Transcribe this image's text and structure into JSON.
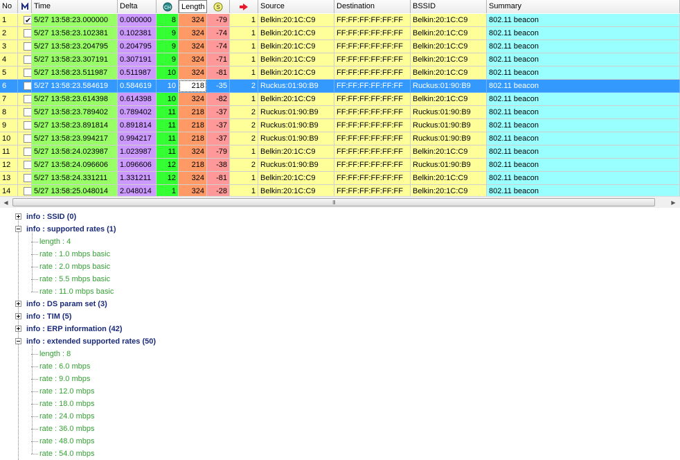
{
  "columns": {
    "no": "No",
    "time": "Time",
    "delta": "Delta",
    "length": "Length",
    "source": "Source",
    "destination": "Destination",
    "bssid": "BSSID",
    "summary": "Summary"
  },
  "column_icons": [
    "mark-icon",
    "channel-icon",
    "signal-icon",
    "retry-arrow-icon"
  ],
  "column_colors": {
    "no": "#ffff99",
    "mark": "#ffff99",
    "time": "#99ff66",
    "delta": "#cc99ff",
    "channel": "#33ff33",
    "length": "#ff9966",
    "signal": "#ff9999",
    "retry": "#ffff99",
    "addresses": "#ffff99",
    "summary": "#99ffff",
    "selected_row": "#3399ff"
  },
  "packets": [
    {
      "no": "1",
      "marked": true,
      "time": "5/27 13:58:23.000000",
      "delta": "0.000000",
      "ch": "8",
      "len": "324",
      "sig": "-79",
      "r": "1",
      "src": "Belkin:20:1C:C9",
      "dst": "FF:FF:FF:FF:FF:FF",
      "bssid": "Belkin:20:1C:C9",
      "summary": "802.11 beacon"
    },
    {
      "no": "2",
      "marked": false,
      "time": "5/27 13:58:23.102381",
      "delta": "0.102381",
      "ch": "9",
      "len": "324",
      "sig": "-74",
      "r": "1",
      "src": "Belkin:20:1C:C9",
      "dst": "FF:FF:FF:FF:FF:FF",
      "bssid": "Belkin:20:1C:C9",
      "summary": "802.11 beacon"
    },
    {
      "no": "3",
      "marked": false,
      "time": "5/27 13:58:23.204795",
      "delta": "0.204795",
      "ch": "9",
      "len": "324",
      "sig": "-74",
      "r": "1",
      "src": "Belkin:20:1C:C9",
      "dst": "FF:FF:FF:FF:FF:FF",
      "bssid": "Belkin:20:1C:C9",
      "summary": "802.11 beacon"
    },
    {
      "no": "4",
      "marked": false,
      "time": "5/27 13:58:23.307191",
      "delta": "0.307191",
      "ch": "9",
      "len": "324",
      "sig": "-71",
      "r": "1",
      "src": "Belkin:20:1C:C9",
      "dst": "FF:FF:FF:FF:FF:FF",
      "bssid": "Belkin:20:1C:C9",
      "summary": "802.11 beacon"
    },
    {
      "no": "5",
      "marked": false,
      "time": "5/27 13:58:23.511987",
      "delta": "0.511987",
      "ch": "10",
      "len": "324",
      "sig": "-81",
      "r": "1",
      "src": "Belkin:20:1C:C9",
      "dst": "FF:FF:FF:FF:FF:FF",
      "bssid": "Belkin:20:1C:C9",
      "summary": "802.11 beacon"
    },
    {
      "no": "6",
      "marked": false,
      "selected": true,
      "time": "5/27 13:58:23.584619",
      "delta": "0.584619",
      "ch": "10",
      "len": "218",
      "sig": "-35",
      "r": "2",
      "src": "Ruckus:01:90:B9",
      "dst": "FF:FF:FF:FF:FF:FF",
      "bssid": "Ruckus:01:90:B9",
      "summary": "802.11 beacon"
    },
    {
      "no": "7",
      "marked": false,
      "time": "5/27 13:58:23.614398",
      "delta": "0.614398",
      "ch": "10",
      "len": "324",
      "sig": "-82",
      "r": "1",
      "src": "Belkin:20:1C:C9",
      "dst": "FF:FF:FF:FF:FF:FF",
      "bssid": "Belkin:20:1C:C9",
      "summary": "802.11 beacon"
    },
    {
      "no": "8",
      "marked": false,
      "time": "5/27 13:58:23.789402",
      "delta": "0.789402",
      "ch": "11",
      "len": "218",
      "sig": "-37",
      "r": "2",
      "src": "Ruckus:01:90:B9",
      "dst": "FF:FF:FF:FF:FF:FF",
      "bssid": "Ruckus:01:90:B9",
      "summary": "802.11 beacon"
    },
    {
      "no": "9",
      "marked": false,
      "time": "5/27 13:58:23.891814",
      "delta": "0.891814",
      "ch": "11",
      "len": "218",
      "sig": "-37",
      "r": "2",
      "src": "Ruckus:01:90:B9",
      "dst": "FF:FF:FF:FF:FF:FF",
      "bssid": "Ruckus:01:90:B9",
      "summary": "802.11 beacon"
    },
    {
      "no": "10",
      "marked": false,
      "time": "5/27 13:58:23.994217",
      "delta": "0.994217",
      "ch": "11",
      "len": "218",
      "sig": "-37",
      "r": "2",
      "src": "Ruckus:01:90:B9",
      "dst": "FF:FF:FF:FF:FF:FF",
      "bssid": "Ruckus:01:90:B9",
      "summary": "802.11 beacon"
    },
    {
      "no": "11",
      "marked": false,
      "time": "5/27 13:58:24.023987",
      "delta": "1.023987",
      "ch": "11",
      "len": "324",
      "sig": "-79",
      "r": "1",
      "src": "Belkin:20:1C:C9",
      "dst": "FF:FF:FF:FF:FF:FF",
      "bssid": "Belkin:20:1C:C9",
      "summary": "802.11 beacon"
    },
    {
      "no": "12",
      "marked": false,
      "time": "5/27 13:58:24.096606",
      "delta": "1.096606",
      "ch": "12",
      "len": "218",
      "sig": "-38",
      "r": "2",
      "src": "Ruckus:01:90:B9",
      "dst": "FF:FF:FF:FF:FF:FF",
      "bssid": "Ruckus:01:90:B9",
      "summary": "802.11 beacon"
    },
    {
      "no": "13",
      "marked": false,
      "time": "5/27 13:58:24.331211",
      "delta": "1.331211",
      "ch": "12",
      "len": "324",
      "sig": "-81",
      "r": "1",
      "src": "Belkin:20:1C:C9",
      "dst": "FF:FF:FF:FF:FF:FF",
      "bssid": "Belkin:20:1C:C9",
      "summary": "802.11 beacon"
    },
    {
      "no": "14",
      "marked": false,
      "time": "5/27 13:58:25.048014",
      "delta": "2.048014",
      "ch": "1",
      "len": "324",
      "sig": "-28",
      "r": "1",
      "src": "Belkin:20:1C:C9",
      "dst": "FF:FF:FF:FF:FF:FF",
      "bssid": "Belkin:20:1C:C9",
      "summary": "802.11 beacon"
    }
  ],
  "scrollbar": {
    "grip": "III"
  },
  "tree": [
    {
      "label": "info : SSID (0)",
      "expanded": false,
      "children": []
    },
    {
      "label": "info : supported rates (1)",
      "expanded": true,
      "children": [
        "length : 4",
        "rate : 1.0 mbps basic",
        "rate : 2.0 mbps basic",
        "rate : 5.5 mbps basic",
        "rate : 11.0 mbps basic"
      ]
    },
    {
      "label": "info : DS param set (3)",
      "expanded": false,
      "children": []
    },
    {
      "label": "info : TIM (5)",
      "expanded": false,
      "children": []
    },
    {
      "label": "info : ERP information (42)",
      "expanded": false,
      "children": []
    },
    {
      "label": "info : extended supported rates (50)",
      "expanded": true,
      "children": [
        "length : 8",
        "rate : 6.0 mbps",
        "rate : 9.0 mbps",
        "rate : 12.0 mbps",
        "rate : 18.0 mbps",
        "rate : 24.0 mbps",
        "rate : 36.0 mbps",
        "rate : 48.0 mbps",
        "rate : 54.0 mbps"
      ]
    }
  ]
}
